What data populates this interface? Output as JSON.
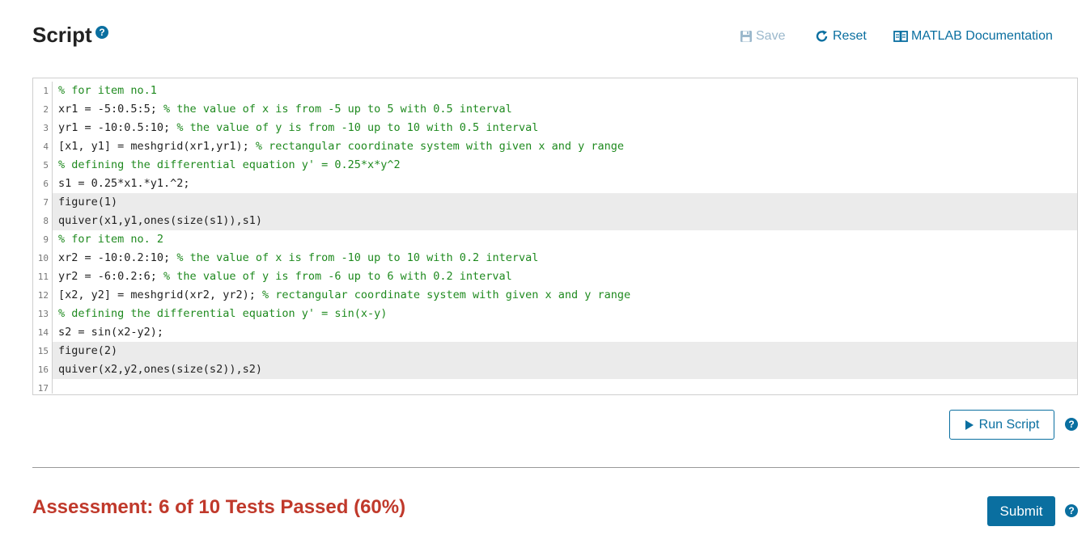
{
  "header": {
    "title": "Script",
    "help": "?",
    "save_label": "Save",
    "reset_label": "Reset",
    "docs_label": "MATLAB Documentation"
  },
  "editor": {
    "lines": [
      {
        "num": "1",
        "code": "",
        "comment": "% for item no.1"
      },
      {
        "num": "2",
        "code": "xr1 = -5:0.5:5; ",
        "comment": "% the value of x is from -5 up to 5 with 0.5 interval"
      },
      {
        "num": "3",
        "code": "yr1 = -10:0.5:10; ",
        "comment": "% the value of y is from -10 up to 10 with 0.5 interval"
      },
      {
        "num": "4",
        "code": "[x1, y1] = meshgrid(xr1,yr1); ",
        "comment": "% rectangular coordinate system with given x and y range"
      },
      {
        "num": "5",
        "code": "",
        "comment": "% defining the differential equation y' = 0.25*x*y^2"
      },
      {
        "num": "6",
        "code": "s1 = 0.25*x1.*y1.^2;",
        "comment": ""
      },
      {
        "num": "7",
        "code": "figure(1)",
        "comment": ""
      },
      {
        "num": "8",
        "code": "quiver(x1,y1,ones(size(s1)),s1)",
        "comment": ""
      },
      {
        "num": "9",
        "code": "",
        "comment": "% for item no. 2"
      },
      {
        "num": "10",
        "code": "xr2 = -10:0.2:10; ",
        "comment": "% the value of x is from -10 up to 10 with 0.2 interval"
      },
      {
        "num": "11",
        "code": "yr2 = -6:0.2:6; ",
        "comment": "% the value of y is from -6 up to 6 with 0.2 interval"
      },
      {
        "num": "12",
        "code": "[x2, y2] = meshgrid(xr2, yr2); ",
        "comment": "% rectangular coordinate system with given x and y range"
      },
      {
        "num": "13",
        "code": "",
        "comment": "% defining the differential equation y' = sin(x-y)"
      },
      {
        "num": "14",
        "code": "s2 = sin(x2-y2);",
        "comment": ""
      },
      {
        "num": "15",
        "code": "figure(2)",
        "comment": ""
      },
      {
        "num": "16",
        "code": "quiver(x2,y2,ones(size(s2)),s2)",
        "comment": ""
      },
      {
        "num": "17",
        "code": "",
        "comment": ""
      }
    ]
  },
  "actions": {
    "run_label": "Run Script",
    "submit_label": "Submit",
    "help": "?"
  },
  "assessment": {
    "text": "Assessment: 6 of 10 Tests Passed (60%)"
  }
}
